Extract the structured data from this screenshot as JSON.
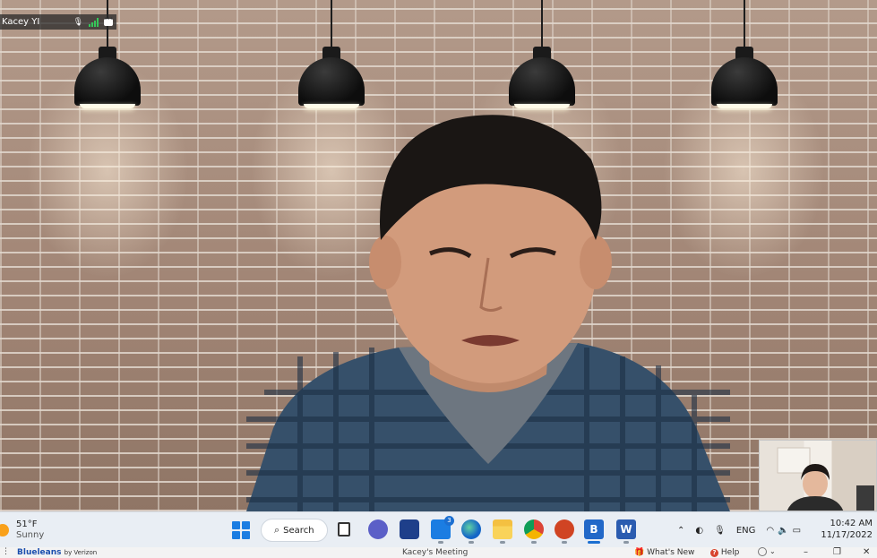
{
  "meeting": {
    "participant_name": "Kacey YI",
    "self_view_label": ""
  },
  "taskbar": {
    "weather_temp": "51°F",
    "weather_desc": "Sunny",
    "search_label": "Search",
    "mail_badge": "3",
    "language": "ENG",
    "time": "10:42 AM",
    "date": "11/17/2022",
    "accent_color": "#1b6fd1"
  },
  "app_footer": {
    "brand": "Blueleans",
    "brand_suffix": "by Verizon",
    "window_title": "Kacey's Meeting",
    "whats_new": "What's New",
    "help": "Help"
  },
  "icons": {
    "mic": "microphone-icon",
    "signal": "signal-bars-icon",
    "chat": "chat-icon",
    "start": "windows-start-icon",
    "search": "search-icon",
    "task_view": "task-view-icon",
    "teams": "teams-chat-icon",
    "store": "store-icon",
    "mail": "mail-icon",
    "edge": "edge-browser-icon",
    "explorer": "file-explorer-icon",
    "chrome": "chrome-icon",
    "powerpoint": "powerpoint-icon",
    "bluejeans": "bluejeans-icon",
    "word": "word-icon"
  }
}
